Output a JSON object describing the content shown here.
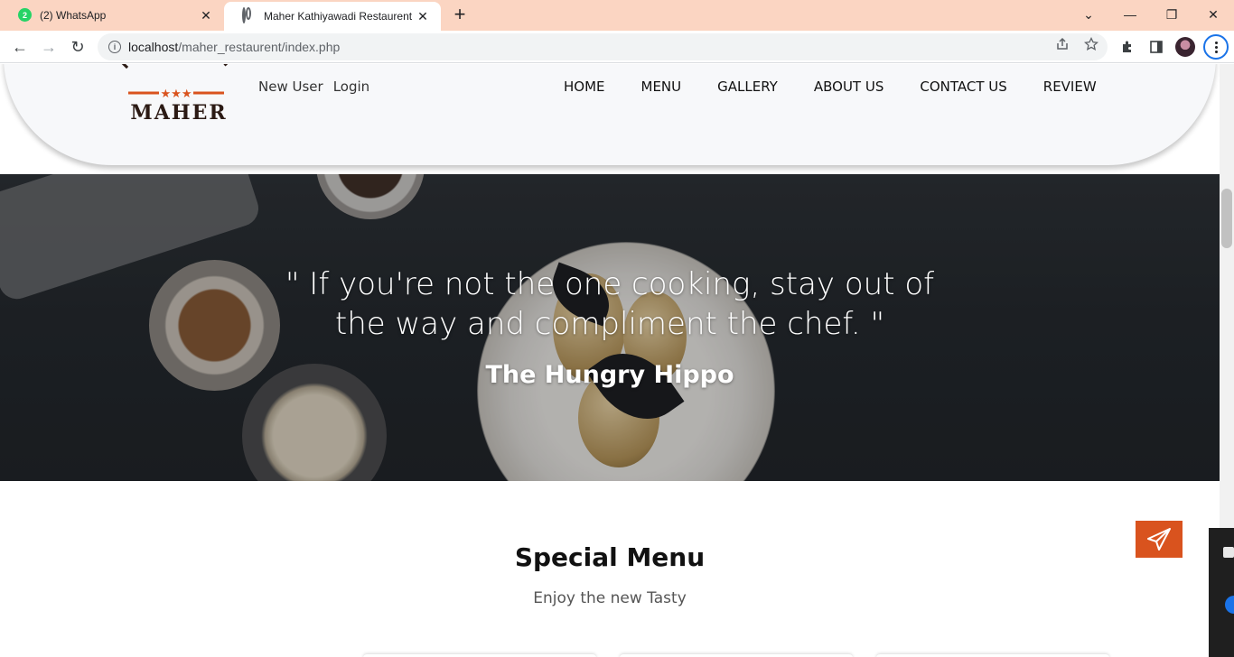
{
  "browser": {
    "tabs": [
      {
        "title": "(2) WhatsApp",
        "badge": "2",
        "active": false
      },
      {
        "title": "Maher Kathiyawadi Restaurent",
        "active": true
      }
    ],
    "url_host": "localhost",
    "url_path": "/maher_restaurent/index.php",
    "close_glyph": "✕",
    "new_tab_glyph": "+",
    "window_controls": {
      "chevron": "⌄",
      "minimize": "—",
      "restore": "❐",
      "close": "✕"
    },
    "nav": {
      "back": "←",
      "forward": "→",
      "reload": "↻"
    }
  },
  "header": {
    "logo": {
      "top_text": "RESTAURANT",
      "bottom_text": "MAHER",
      "stars": "★★★"
    },
    "auth_links": [
      "New User",
      "Login"
    ],
    "nav_items": [
      "HOME",
      "MENU",
      "GALLERY",
      "ABOUT US",
      "CONTACT US",
      "REVIEW"
    ]
  },
  "hero": {
    "quote": "\" If you're not the one cooking, stay out of the way and compliment the chef. \"",
    "author": "The Hungry Hippo"
  },
  "special_menu": {
    "title": "Special Menu",
    "subtitle": "Enjoy the new Tasty"
  },
  "colors": {
    "tab_strip": "#fbd5c2",
    "header_bg": "#f7f8fa",
    "logo_dark": "#2b1a14",
    "logo_accent": "#d9531e",
    "send_button": "#d9531e"
  },
  "icons": {
    "send": "paper-plane-icon",
    "share": "share-icon",
    "bookmark": "star-icon",
    "extensions": "puzzle-icon",
    "side_panel": "side-panel-icon"
  }
}
